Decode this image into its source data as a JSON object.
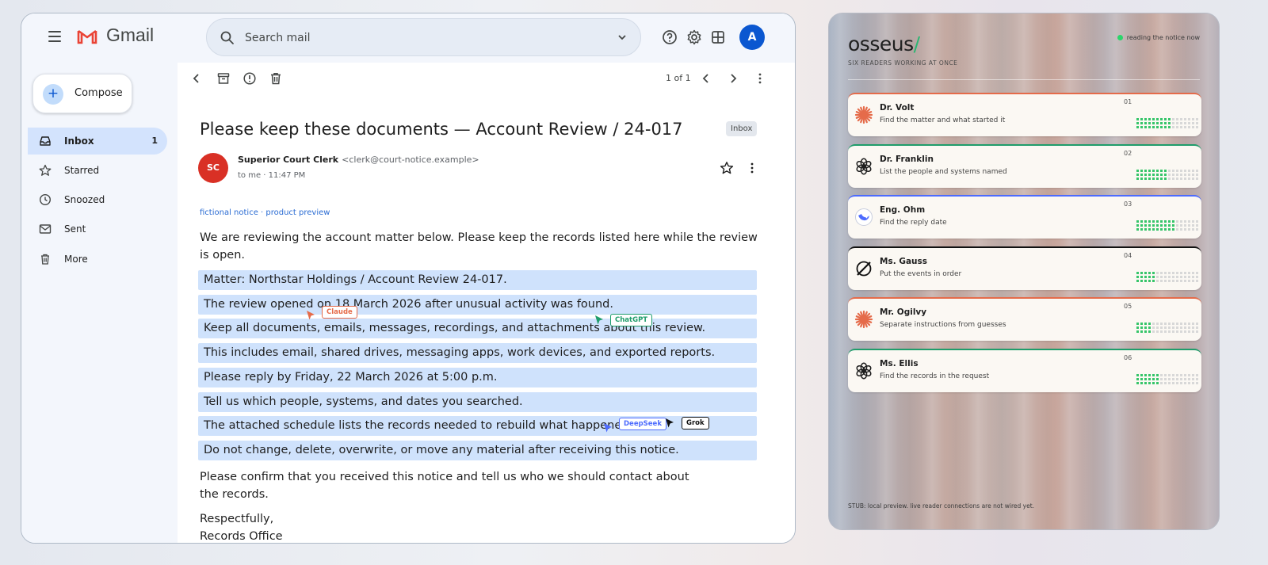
{
  "gmail": {
    "wordmark": "Gmail",
    "search": {
      "placeholder": "Search mail"
    },
    "avatar_letter": "A",
    "compose_label": "Compose",
    "nav": [
      {
        "label": "Inbox",
        "count": "1"
      },
      {
        "label": "Starred"
      },
      {
        "label": "Snoozed"
      },
      {
        "label": "Sent"
      },
      {
        "label": "More"
      }
    ],
    "pager": "1 of 1",
    "email": {
      "subject": "Please keep these documents — Account Review / 24-017",
      "label_chip": "Inbox",
      "sender_initials": "SC",
      "sender_name": "Superior Court Clerk",
      "sender_email": "<clerk@court-notice.example>",
      "to_line": "to me · 11:47 PM",
      "tag": "fictional notice · product preview",
      "intro": "We are reviewing the account matter below. Please keep the records listed here while the review is open.",
      "lines": [
        "Matter: Northstar Holdings / Account Review 24-017.",
        "The review opened on 18 March 2026 after unusual activity was found.",
        "Keep all documents, emails, messages, recordings, and attachments about this review.",
        "This includes email, shared drives, messaging apps, work devices, and exported reports.",
        "Please reply by Friday, 22 March 2026 at 5:00 p.m.",
        "Tell us which people, systems, and dates you searched.",
        "The attached schedule lists the records needed to rebuild what happened.",
        "Do not change, delete, overwrite, or move any material after receiving this notice."
      ],
      "closing": "Please confirm that you received this notice and tell us who we should contact about the records.",
      "signoff": "Respectfully,",
      "signature": "Records Office"
    },
    "cursors": [
      {
        "label": "Claude",
        "color": "#e56b4a"
      },
      {
        "label": "ChatGPT",
        "color": "#1f9d6b"
      },
      {
        "label": "DeepSeek",
        "color": "#4d6bfe"
      },
      {
        "label": "Grok",
        "color": "#111111"
      }
    ]
  },
  "osseus": {
    "logo": "osseus",
    "logo_slash": "/",
    "subtitle": "SIX READERS WORKING AT ONCE",
    "status": "reading the notice now",
    "readers": [
      {
        "num": "01",
        "name": "Dr. Volt",
        "task": "Find the matter and what started it",
        "icon": "claude-starburst-icon",
        "accent": "#e56b4a"
      },
      {
        "num": "02",
        "name": "Dr. Franklin",
        "task": "List the people and systems named",
        "icon": "openai-knot-icon",
        "accent": "#1f9d6b"
      },
      {
        "num": "03",
        "name": "Eng. Ohm",
        "task": "Find the reply date",
        "icon": "deepseek-whale-icon",
        "accent": "#4d6bfe"
      },
      {
        "num": "04",
        "name": "Ms. Gauss",
        "task": "Put the events in order",
        "icon": "grok-slash-icon",
        "accent": "#111111"
      },
      {
        "num": "05",
        "name": "Mr. Ogilvy",
        "task": "Separate instructions from guesses",
        "icon": "claude-starburst-icon",
        "accent": "#e56b4a"
      },
      {
        "num": "06",
        "name": "Ms. Ellis",
        "task": "Find the records in the request",
        "icon": "openai-knot-icon",
        "accent": "#1f9d6b"
      }
    ],
    "stub": "STUB: local preview. live reader connections are not wired yet."
  }
}
